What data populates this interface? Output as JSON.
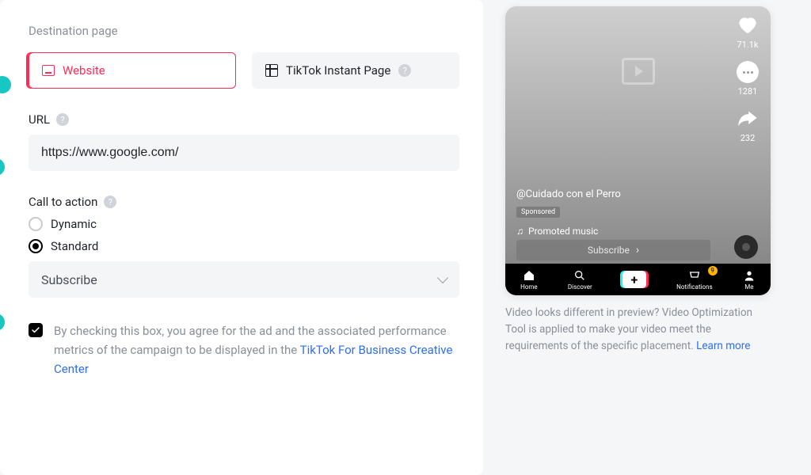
{
  "destination": {
    "title": "Destination page",
    "option_website": "Website",
    "option_instant": "TikTok Instant Page",
    "selected": "website"
  },
  "url": {
    "label": "URL",
    "value": "https://www.google.com/"
  },
  "cta": {
    "label": "Call to action",
    "options": {
      "dynamic": "Dynamic",
      "standard": "Standard"
    },
    "selected": "standard",
    "dropdown_value": "Subscribe"
  },
  "agreement": {
    "checked": true,
    "text_prefix": "By checking this box, you agree for the ad and the associated performance metrics of the campaign to be displayed in the ",
    "link_text": "TikTok For Business Creative Center"
  },
  "preview": {
    "handle": "@Cuidado con el Perro",
    "sponsored_label": "Sponsored",
    "music_label": "Promoted music",
    "cta_button": "Subscribe",
    "likes": "71.1k",
    "comments": "1281",
    "shares": "232",
    "tabs": {
      "home": "Home",
      "discover": "Discover",
      "notifications": "Notifications",
      "me": "Me",
      "badge": "9"
    },
    "note_prefix": "Video looks different in preview? Video Optimization Tool is applied to make your video meet the requirements of the specific placement. ",
    "note_link": "Learn more"
  }
}
